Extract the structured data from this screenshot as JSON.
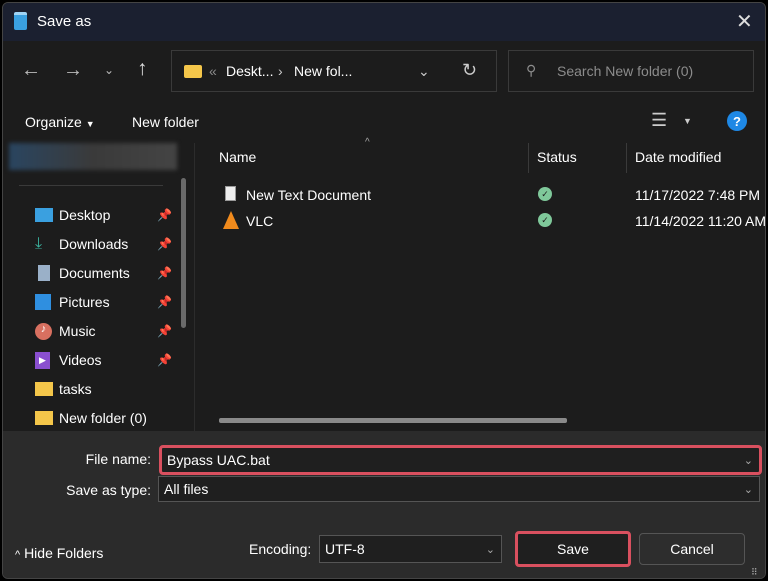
{
  "title": "Save as",
  "nav": {
    "breadcrumb_prefix": "«",
    "crumbs": [
      "Deskt...",
      "New fol..."
    ],
    "search_placeholder": "Search New folder (0)"
  },
  "toolbar": {
    "organize": "Organize",
    "new_folder": "New folder",
    "help": "?"
  },
  "sidebar": {
    "items": [
      {
        "label": "Desktop",
        "pinned": true
      },
      {
        "label": "Downloads",
        "pinned": true
      },
      {
        "label": "Documents",
        "pinned": true
      },
      {
        "label": "Pictures",
        "pinned": true
      },
      {
        "label": "Music",
        "pinned": true
      },
      {
        "label": "Videos",
        "pinned": true
      },
      {
        "label": "tasks",
        "pinned": false
      },
      {
        "label": "New folder (0)",
        "pinned": false
      }
    ]
  },
  "columns": {
    "name": "Name",
    "status": "Status",
    "date": "Date modified"
  },
  "files": [
    {
      "name": "New Text Document",
      "status": "synced",
      "date": "11/17/2022 7:48 PM"
    },
    {
      "name": "VLC",
      "status": "synced",
      "date": "11/14/2022 11:20 AM"
    }
  ],
  "form": {
    "file_name_label": "File name:",
    "file_name": "Bypass UAC.bat",
    "type_label": "Save as type:",
    "type": "All files",
    "encoding_label": "Encoding:",
    "encoding": "UTF-8"
  },
  "buttons": {
    "hide_folders": "Hide Folders",
    "save": "Save",
    "cancel": "Cancel"
  },
  "colors": {
    "highlight": "#d9505f",
    "accent": "#1e88e5",
    "status_ok": "#7fc89a"
  }
}
